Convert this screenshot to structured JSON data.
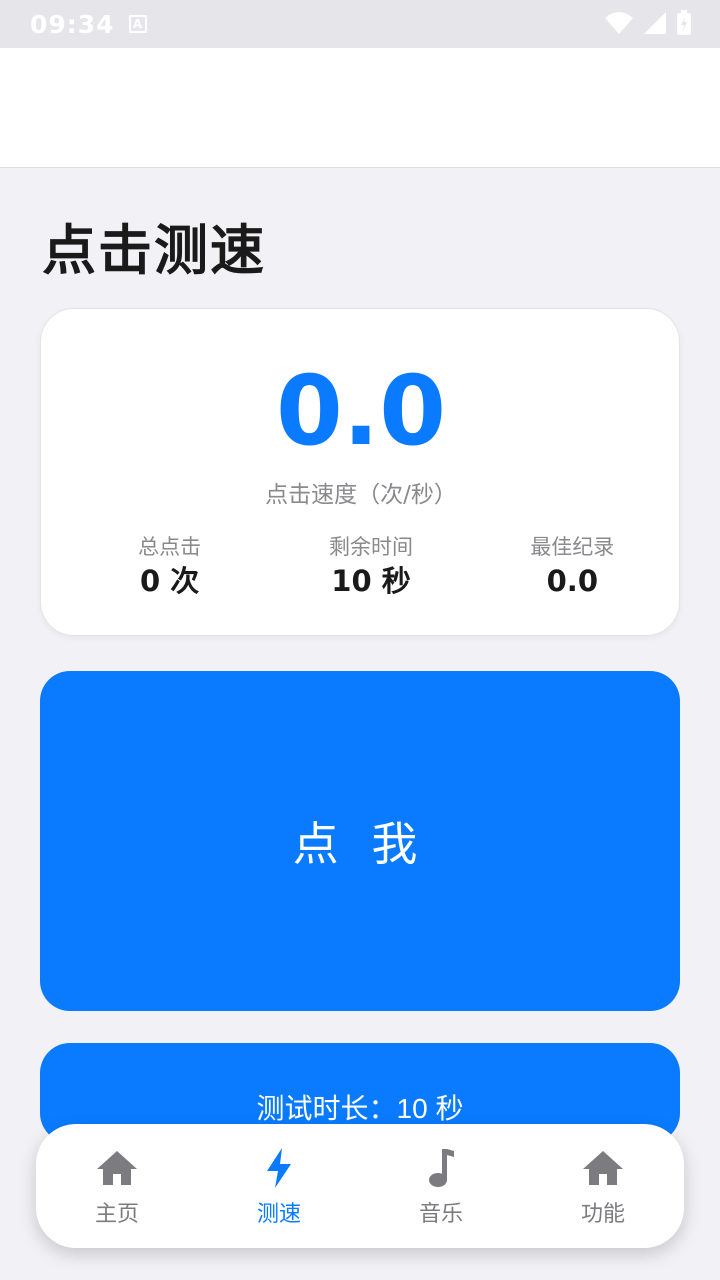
{
  "status": {
    "time": "09:34"
  },
  "page": {
    "title": "点击测速"
  },
  "speed": {
    "value": "0.0",
    "label": "点击速度（次/秒）"
  },
  "stats": [
    {
      "label": "总点击",
      "value": "0 次"
    },
    {
      "label": "剩余时间",
      "value": "10 秒"
    },
    {
      "label": "最佳纪录",
      "value": "0.0"
    }
  ],
  "buttons": {
    "tap": "点 我",
    "duration": "测试时长：10 秒"
  },
  "nav": [
    {
      "label": "主页",
      "icon": "home-icon",
      "active": false
    },
    {
      "label": "测速",
      "icon": "bolt-icon",
      "active": true
    },
    {
      "label": "音乐",
      "icon": "music-note-icon",
      "active": false
    },
    {
      "label": "功能",
      "icon": "home-icon",
      "active": false
    }
  ],
  "colors": {
    "accent": "#0a7bff",
    "inactive": "#7c7c80"
  }
}
